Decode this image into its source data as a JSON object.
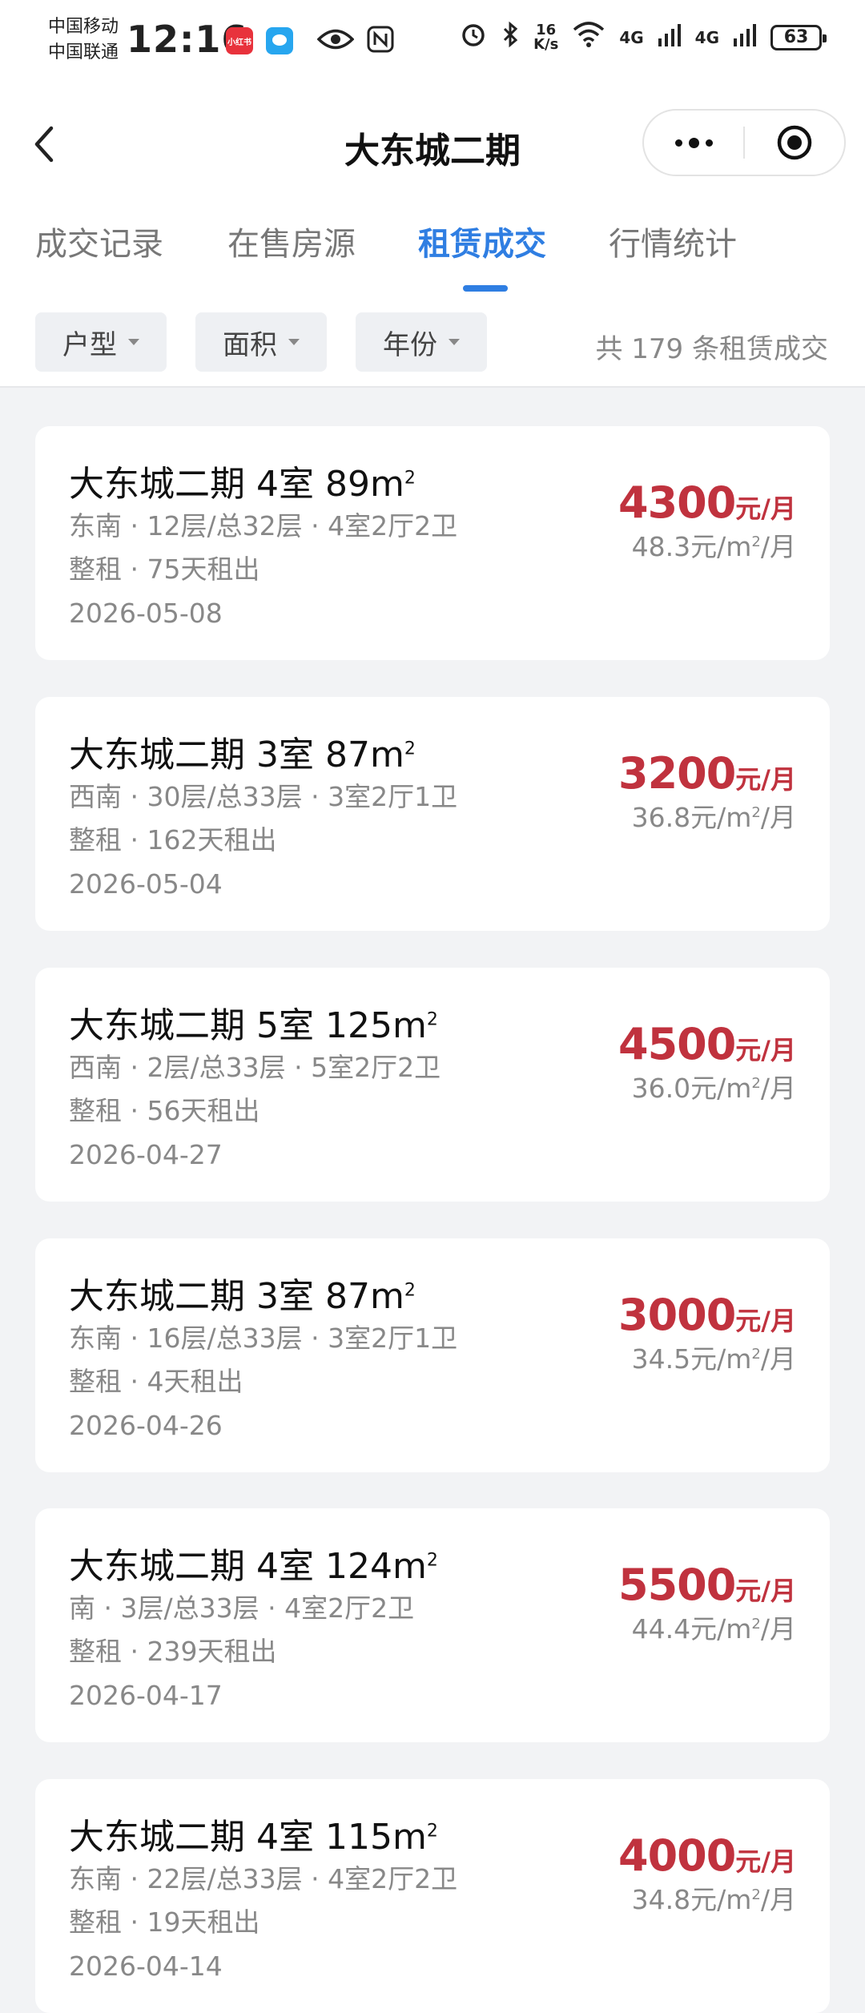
{
  "status_bar": {
    "carrier1": "中国移动",
    "carrier2": "中国联通",
    "time": "12:16",
    "app_badge1": "小红书",
    "speed_value": "16",
    "speed_unit": "K/s",
    "net1": "4G",
    "net2": "4G",
    "battery": "63"
  },
  "nav": {
    "title": "大东城二期"
  },
  "tabs": [
    {
      "label": "成交记录"
    },
    {
      "label": "在售房源"
    },
    {
      "label": "租赁成交"
    },
    {
      "label": "行情统计"
    }
  ],
  "active_tab": "租赁成交",
  "filters": [
    {
      "label": "户型"
    },
    {
      "label": "面积"
    },
    {
      "label": "年份"
    }
  ],
  "count_text": "共 179 条租赁成交",
  "listings": [
    {
      "title": "大东城二期 4室 89m",
      "sup": "2",
      "orientation": "东南",
      "floor": "12层/总32层",
      "layout": "4室2厅2卫",
      "rent_type": "整租",
      "days": "75天租出",
      "date": "2026-05-08",
      "price": "4300",
      "price_unit": "元/月",
      "unit_price_prefix": "48.3元/m",
      "unit_price_suffix": "/月"
    },
    {
      "title": "大东城二期 3室 87m",
      "sup": "2",
      "orientation": "西南",
      "floor": "30层/总33层",
      "layout": "3室2厅1卫",
      "rent_type": "整租",
      "days": "162天租出",
      "date": "2026-05-04",
      "price": "3200",
      "price_unit": "元/月",
      "unit_price_prefix": "36.8元/m",
      "unit_price_suffix": "/月"
    },
    {
      "title": "大东城二期 5室 125m",
      "sup": "2",
      "orientation": "西南",
      "floor": "2层/总33层",
      "layout": "5室2厅2卫",
      "rent_type": "整租",
      "days": "56天租出",
      "date": "2026-04-27",
      "price": "4500",
      "price_unit": "元/月",
      "unit_price_prefix": "36.0元/m",
      "unit_price_suffix": "/月"
    },
    {
      "title": "大东城二期 3室 87m",
      "sup": "2",
      "orientation": "东南",
      "floor": "16层/总33层",
      "layout": "3室2厅1卫",
      "rent_type": "整租",
      "days": "4天租出",
      "date": "2026-04-26",
      "price": "3000",
      "price_unit": "元/月",
      "unit_price_prefix": "34.5元/m",
      "unit_price_suffix": "/月"
    },
    {
      "title": "大东城二期 4室 124m",
      "sup": "2",
      "orientation": "南",
      "floor": "3层/总33层",
      "layout": "4室2厅2卫",
      "rent_type": "整租",
      "days": "239天租出",
      "date": "2026-04-17",
      "price": "5500",
      "price_unit": "元/月",
      "unit_price_prefix": "44.4元/m",
      "unit_price_suffix": "/月"
    },
    {
      "title": "大东城二期 4室 115m",
      "sup": "2",
      "orientation": "东南",
      "floor": "22层/总33层",
      "layout": "4室2厅2卫",
      "rent_type": "整租",
      "days": "19天租出",
      "date": "2026-04-14",
      "price": "4000",
      "price_unit": "元/月",
      "unit_price_prefix": "34.8元/m",
      "unit_price_suffix": "/月"
    }
  ],
  "colors": {
    "accent": "#2f7ee2",
    "price": "#c0323e",
    "background": "#f2f3f5"
  }
}
